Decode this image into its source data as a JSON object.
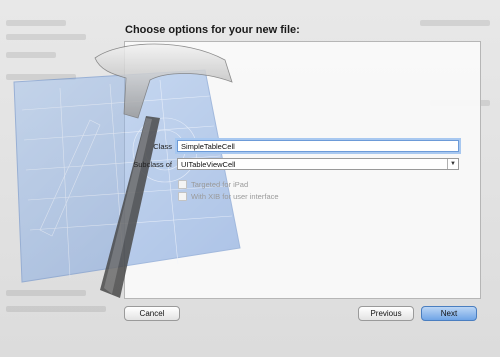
{
  "dialog": {
    "title": "Choose options for your new file:"
  },
  "form": {
    "class_label": "Class",
    "class_value": "SimpleTableCell",
    "subclass_label": "Subclass of",
    "subclass_value": "UITableViewCell",
    "targeted_ipad_label": "Targeted for iPad",
    "targeted_ipad_checked": false,
    "with_xib_label": "With XIB for user interface",
    "with_xib_checked": false
  },
  "buttons": {
    "cancel": "Cancel",
    "previous": "Previous",
    "next": "Next"
  },
  "colors": {
    "accent": "#6fa4e6",
    "blueprint": "#8fb4e8"
  }
}
